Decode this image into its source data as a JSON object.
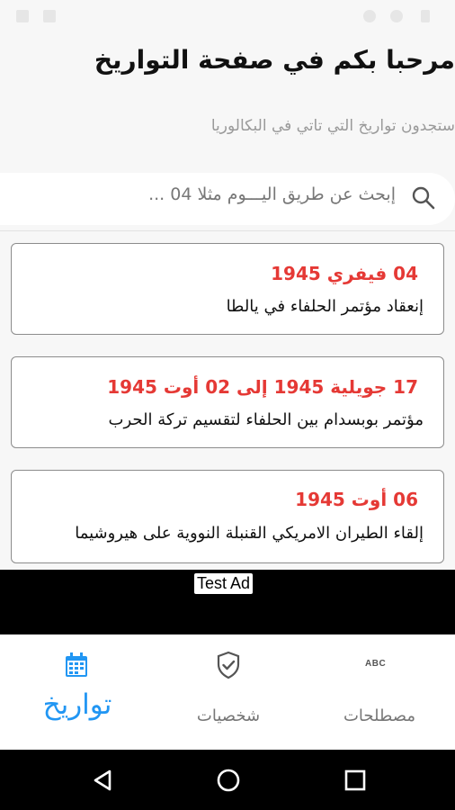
{
  "header": {
    "title": "مرحبا بكم في صفحة التواريخ",
    "subtitle": "ستجدون تواريخ التي تاتي في البكالوريا"
  },
  "search": {
    "placeholder": "إبحث عن طريق اليـــوم مثلا 04 ..."
  },
  "events": [
    {
      "date": "04 فيفري 1945",
      "description": "إنعقاد مؤتمر الحلفاء في يالطا"
    },
    {
      "date": "17 جويلية 1945 إلى 02 أوت 1945",
      "description": "مؤتمر بوبسدام بين الحلفاء لتقسيم تركة الحرب"
    },
    {
      "date": "06 أوت 1945",
      "description": "إلقاء الطيران الامريكي القنبلة النووية على هيروشيما"
    }
  ],
  "ad": {
    "label": "Test Ad"
  },
  "bottom_nav": {
    "items": [
      {
        "label": "تواريخ",
        "icon": "calendar-icon",
        "active": true
      },
      {
        "label": "شخصيات",
        "icon": "shield-check-icon",
        "active": false
      },
      {
        "label": "مصطلحات",
        "icon": "abc-icon",
        "icon_text": "ABC",
        "active": false
      }
    ]
  },
  "colors": {
    "accent": "#2196f3",
    "date_red": "#e53935",
    "inactive": "#777777"
  }
}
